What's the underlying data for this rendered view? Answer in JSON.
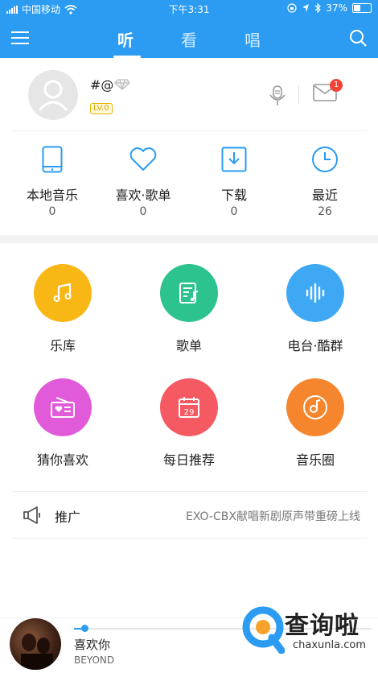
{
  "status_bar": {
    "carrier": "中国移动",
    "time": "下午3:31",
    "battery": "37%"
  },
  "nav": {
    "tabs": [
      {
        "label": "听",
        "active": true
      },
      {
        "label": "看",
        "active": false
      },
      {
        "label": "唱",
        "active": false
      }
    ]
  },
  "profile": {
    "username": "#@",
    "level": "LV.0",
    "mail_badge": "1"
  },
  "quick_access": [
    {
      "label": "本地音乐",
      "count": "0",
      "icon": "phone-icon"
    },
    {
      "label": "喜欢·歌单",
      "count": "0",
      "icon": "heart-icon"
    },
    {
      "label": "下载",
      "count": "0",
      "icon": "download-icon"
    },
    {
      "label": "最近",
      "count": "26",
      "icon": "clock-icon"
    }
  ],
  "grid": [
    {
      "label": "乐库",
      "icon": "music-note-icon",
      "color": "#f9b716"
    },
    {
      "label": "歌单",
      "icon": "playlist-icon",
      "color": "#2cc38e"
    },
    {
      "label": "电台·酷群",
      "icon": "soundwave-icon",
      "color": "#3fa8f4"
    },
    {
      "label": "猜你喜欢",
      "icon": "radio-icon",
      "color": "#e05ad9"
    },
    {
      "label": "每日推荐",
      "icon": "calendar-icon",
      "color": "#f55a63"
    },
    {
      "label": "音乐圈",
      "icon": "disc-icon",
      "color": "#f6862d"
    }
  ],
  "promo": {
    "label": "推广",
    "text": "EXO-CBX献唱新剧原声带重磅上线"
  },
  "player": {
    "song": "喜欢你",
    "artist": "BEYOND",
    "progress": 0.03
  },
  "watermark": {
    "text": "查询啦",
    "url": "chaxunla.com"
  },
  "colors": {
    "accent": "#2b9cf2"
  }
}
